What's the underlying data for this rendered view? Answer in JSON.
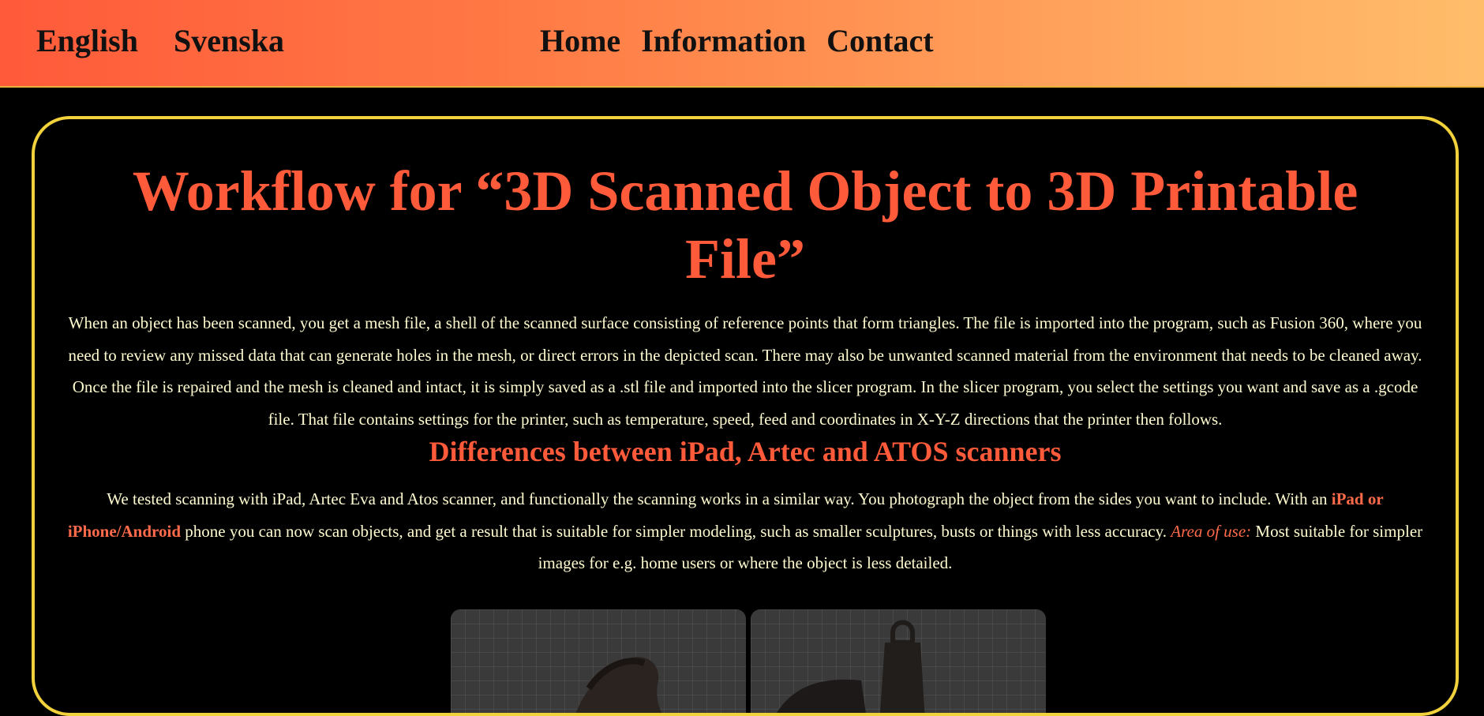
{
  "header": {
    "languages": [
      "English",
      "Svenska"
    ],
    "nav": [
      "Home",
      "Information",
      "Contact"
    ]
  },
  "main": {
    "title": "Workflow for “3D Scanned Object to 3D Printable File”",
    "intro": "When an object has been scanned, you get a mesh file, a shell of the scanned surface consisting of reference points that form triangles. The file is imported into the program, such as Fusion 360, where you need to review any missed data that can generate holes in the mesh, or direct errors in the depicted scan. There may also be unwanted scanned material from the environment that needs to be cleaned away. Once the file is repaired and the mesh is cleaned and intact, it is simply saved as a .stl file and imported into the slicer program. In the slicer program, you select the settings you want and save as a .gcode file. That file contains settings for the printer, such as temperature, speed, feed and coordinates in X-Y-Z directions that the printer then follows.",
    "subtitle": "Differences between iPad, Artec and ATOS scanners",
    "scan_para": {
      "part1": "We tested scanning with iPad, Artec Eva and Atos scanner, and functionally the scanning works in a similar way. You photograph the object from the sides you want to include. With an ",
      "highlight": "iPad or iPhone/Android",
      "part2": " phone you can now scan objects, and get a result that is suitable for simpler modeling, such as smaller sculptures, busts or things with less accuracy. ",
      "area_label": "Area of use:",
      "part3": " Most suitable for simpler images for e.g. home users or where the object is less detailed."
    },
    "images": [
      "scan-preview-ipad",
      "scan-preview-object"
    ]
  },
  "colors": {
    "accent": "#ff5a3a",
    "border": "#f2d23c",
    "body_text": "#fffbd0",
    "background": "#000000"
  }
}
